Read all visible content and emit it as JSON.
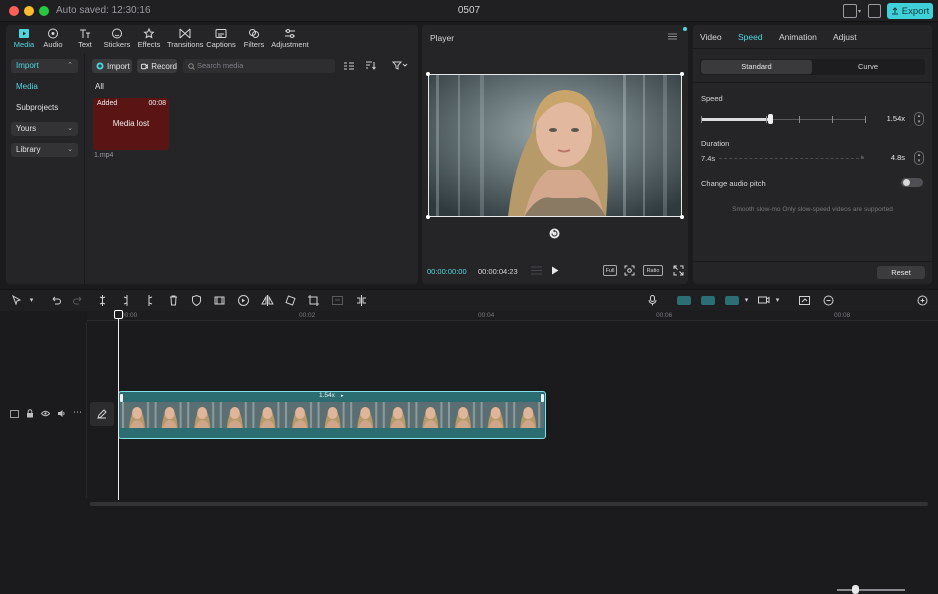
{
  "titlebar": {
    "autosave": "Auto saved: 12:30:16",
    "project_title": "0507",
    "export_label": "Export"
  },
  "media_toolbar": {
    "tabs": [
      {
        "label": "Media",
        "icon": "media-icon"
      },
      {
        "label": "Audio",
        "icon": "audio-icon"
      },
      {
        "label": "Text",
        "icon": "text-icon"
      },
      {
        "label": "Stickers",
        "icon": "stickers-icon"
      },
      {
        "label": "Effects",
        "icon": "effects-icon"
      },
      {
        "label": "Transitions",
        "icon": "transitions-icon"
      },
      {
        "label": "Captions",
        "icon": "captions-icon"
      },
      {
        "label": "Filters",
        "icon": "filters-icon"
      },
      {
        "label": "Adjustment",
        "icon": "adjustment-icon"
      }
    ]
  },
  "media_sidebar": {
    "import": "Import",
    "media": "Media",
    "subprojects": "Subprojects",
    "yours": "Yours",
    "library": "Library"
  },
  "media_main": {
    "import_button": "Import",
    "record_button": "Record",
    "search_placeholder": "Search media",
    "filter_all": "All",
    "card": {
      "added": "Added",
      "duration": "00:08",
      "status": "Media lost",
      "filename": "1.mp4"
    }
  },
  "player": {
    "title": "Player",
    "time_current": "00:00:00:00",
    "time_total": "00:00:04:23",
    "full_label": "Full",
    "ratio_label": "Ratio"
  },
  "inspector": {
    "tabs": [
      "Video",
      "Speed",
      "Animation",
      "Adjust"
    ],
    "active_tab": "Speed",
    "mode_standard": "Standard",
    "mode_curve": "Curve",
    "speed_label": "Speed",
    "speed_value": "1.54x",
    "speed_fraction": 0.42,
    "duration_label": "Duration",
    "duration_from": "7.4s",
    "duration_value": "4.8s",
    "audio_pitch_label": "Change audio pitch",
    "audio_pitch_on": false,
    "smooth_note": "Smooth slow-mo Only slow-speed videos are supported",
    "reset_label": "Reset"
  },
  "timeline": {
    "ruler": [
      "00:00",
      "00:02",
      "00:04",
      "00:06",
      "00:08"
    ],
    "clip_speed_badge": "1.54x",
    "zoom_fraction": 0.26
  },
  "colors": {
    "accent": "#4fd6dd",
    "export": "#3fd0d8",
    "clip": "#2b6d71",
    "media_lost": "#5a1414"
  }
}
